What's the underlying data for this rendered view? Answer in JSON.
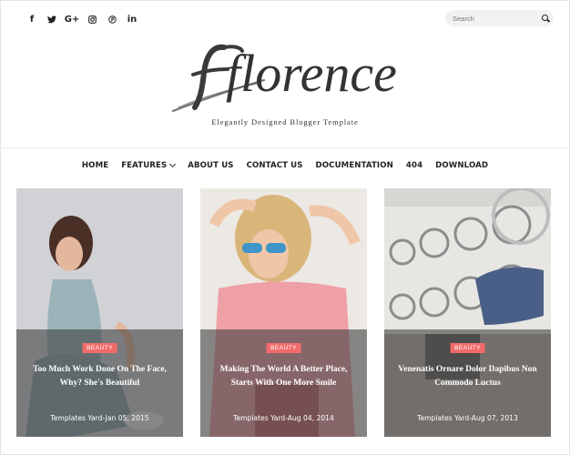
{
  "social": [
    {
      "glyph": "f",
      "icon": "facebook-icon"
    },
    {
      "glyph": "🐦",
      "icon": "twitter-icon"
    },
    {
      "glyph": "G+",
      "icon": "google-plus-icon"
    },
    {
      "glyph": "◙",
      "icon": "instagram-icon"
    },
    {
      "glyph": "℗",
      "icon": "pinterest-icon"
    },
    {
      "glyph": "in",
      "icon": "linkedin-icon"
    }
  ],
  "search": {
    "placeholder": "Search"
  },
  "logo": {
    "text": "florence"
  },
  "tagline": "Elegantly Designed Blogger Template",
  "nav": {
    "home": "HOME",
    "features": "FEATURES",
    "about": "ABOUT US",
    "contact": "CONTACT US",
    "documentation": "DOCUMENTATION",
    "notfound": "404",
    "download": "DOWNLOAD"
  },
  "posts": [
    {
      "badge": "BEAUTY",
      "title": "Too Much Work Done On The Face, Why? She's Beautiful",
      "meta": "Templates Yard-Jan 05, 2015"
    },
    {
      "badge": "BEAUTY",
      "title": "Making The World A Better Place, Starts With One More Smile",
      "meta": "Templates Yard-Aug 04, 2014"
    },
    {
      "badge": "BEAUTY",
      "title": "Venenatis Ornare Dolor Dapibus Non Commodo Luctus",
      "meta": "Templates Yard-Aug 07, 2013"
    }
  ],
  "colors": {
    "badge": "#f26b6b",
    "overlay": "#3c3c3c",
    "text": "#222222"
  }
}
